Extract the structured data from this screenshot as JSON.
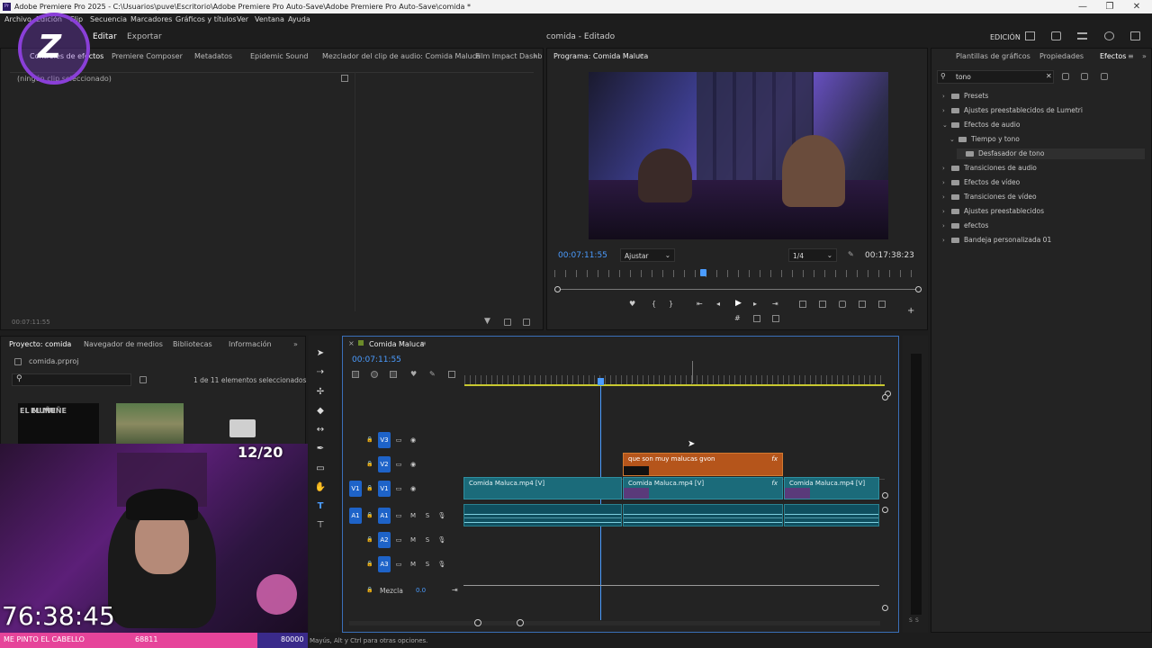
{
  "window": {
    "title": "Adobe Premiere Pro 2025 - C:\\Usuarios\\puve\\Escritorio\\Adobe Premiere Pro Auto-Save\\Adobe Premiere Pro Auto-Save\\comida *",
    "controls": [
      "—",
      "❐",
      "✕"
    ]
  },
  "menu": [
    "Archivo",
    "Edición",
    "Clip",
    "Secuencia",
    "Marcadores",
    "Gráficos y títulos",
    "Ver",
    "Ventana",
    "Ayuda"
  ],
  "header": {
    "tabs": [
      "Editar",
      "Exportar"
    ],
    "center_title": "comida - Editado",
    "workspace": "EDICIÓN"
  },
  "source_panel": {
    "tabs": [
      "Controles de efectos",
      "Premiere Composer",
      "Metadatos",
      "Epidemic Sound",
      "Mezclador del clip de audio: Comida Maluca",
      "Film Impact Dashb"
    ],
    "no_clip": "(ningún clip seleccionado)",
    "timecode": "00:07:11:55"
  },
  "program_monitor": {
    "title": "Programa: Comida Maluca",
    "timecode": "00:07:11:55",
    "fit": "Ajustar",
    "resolution": "1/4",
    "duration": "00:17:38:23",
    "playhead_fraction": 0.405
  },
  "effects_panel": {
    "tabs": [
      "Plantillas de gráficos",
      "Propiedades",
      "Efectos"
    ],
    "search_value": "tono",
    "tree": [
      {
        "label": "Presets",
        "level": 0,
        "open": false
      },
      {
        "label": "Ajustes preestablecidos de Lumetri",
        "level": 0,
        "open": false
      },
      {
        "label": "Efectos de audio",
        "level": 0,
        "open": true
      },
      {
        "label": "Tiempo y tono",
        "level": 1,
        "open": true
      },
      {
        "label": "Desfasador de tono",
        "level": 2,
        "open": false
      },
      {
        "label": "Transiciones de audio",
        "level": 0,
        "open": false
      },
      {
        "label": "Efectos de vídeo",
        "level": 0,
        "open": false
      },
      {
        "label": "Transiciones de vídeo",
        "level": 0,
        "open": false
      },
      {
        "label": "Ajustes preestablecidos",
        "level": 0,
        "open": false
      },
      {
        "label": "efectos",
        "level": 0,
        "open": false
      },
      {
        "label": "Bandeja personalizada 01",
        "level": 0,
        "open": false
      }
    ]
  },
  "project_panel": {
    "tabs": [
      "Proyecto: comida",
      "Navegador de medios",
      "Bibliotecas",
      "Información"
    ],
    "file": "comida.prproj",
    "selection": "1 de 11 elementos seleccionados",
    "thumb_text": "EL MUÑE"
  },
  "timeline": {
    "title": "Comida Maluca",
    "timecode": "00:07:11:55",
    "tracks_video": [
      "V3",
      "V2",
      "V1"
    ],
    "tracks_audio": [
      "A1",
      "A2",
      "A3"
    ],
    "source_patch_video": "V1",
    "source_patch_audio": "A1",
    "mix_label": "Mezcla",
    "mix_value": "0.0",
    "mute_label": "M",
    "solo_label": "S",
    "clips": {
      "title_clip": "que son muy malucas gvon",
      "v1_a": "Comida Maluca.mp4 [V]",
      "v1_b": "Comida Maluca.mp4 [V]",
      "v1_c": "Comida Maluca.mp4 [V]",
      "fx": "fx"
    }
  },
  "overlay": {
    "counter": "12/20",
    "timer": "76:38:45",
    "bar_left": "ME PINTO EL CABELLO",
    "bar_mid": "68811",
    "bar_right": "80000"
  },
  "status": "Mayús, Alt y Ctrl para otras opciones."
}
